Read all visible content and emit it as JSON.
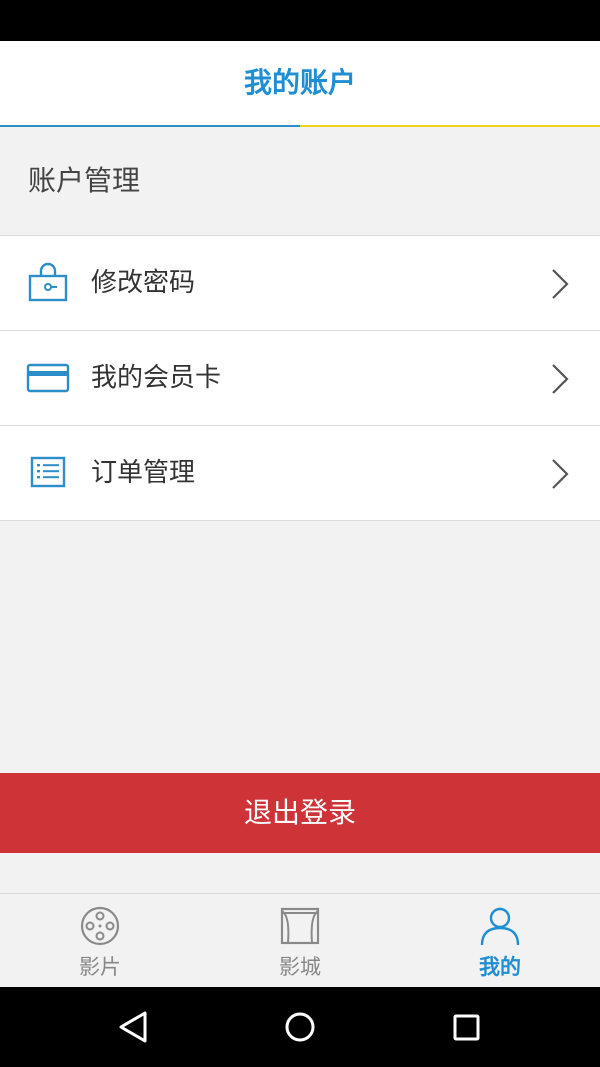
{
  "header": {
    "title": "我的账户"
  },
  "section": {
    "title": "账户管理"
  },
  "menu": {
    "items": [
      {
        "label": "修改密码",
        "icon": "lock-bag-icon"
      },
      {
        "label": "我的会员卡",
        "icon": "credit-card-icon"
      },
      {
        "label": "订单管理",
        "icon": "list-icon"
      }
    ]
  },
  "logout": {
    "label": "退出登录"
  },
  "tabbar": {
    "tabs": [
      {
        "label": "影片",
        "icon": "film-reel-icon",
        "active": false
      },
      {
        "label": "影城",
        "icon": "cinema-icon",
        "active": false
      },
      {
        "label": "我的",
        "icon": "user-icon",
        "active": true
      }
    ]
  },
  "colors": {
    "accent": "#1f8ed3",
    "logout": "#cd3337",
    "underline_alt": "#f2d21b"
  }
}
